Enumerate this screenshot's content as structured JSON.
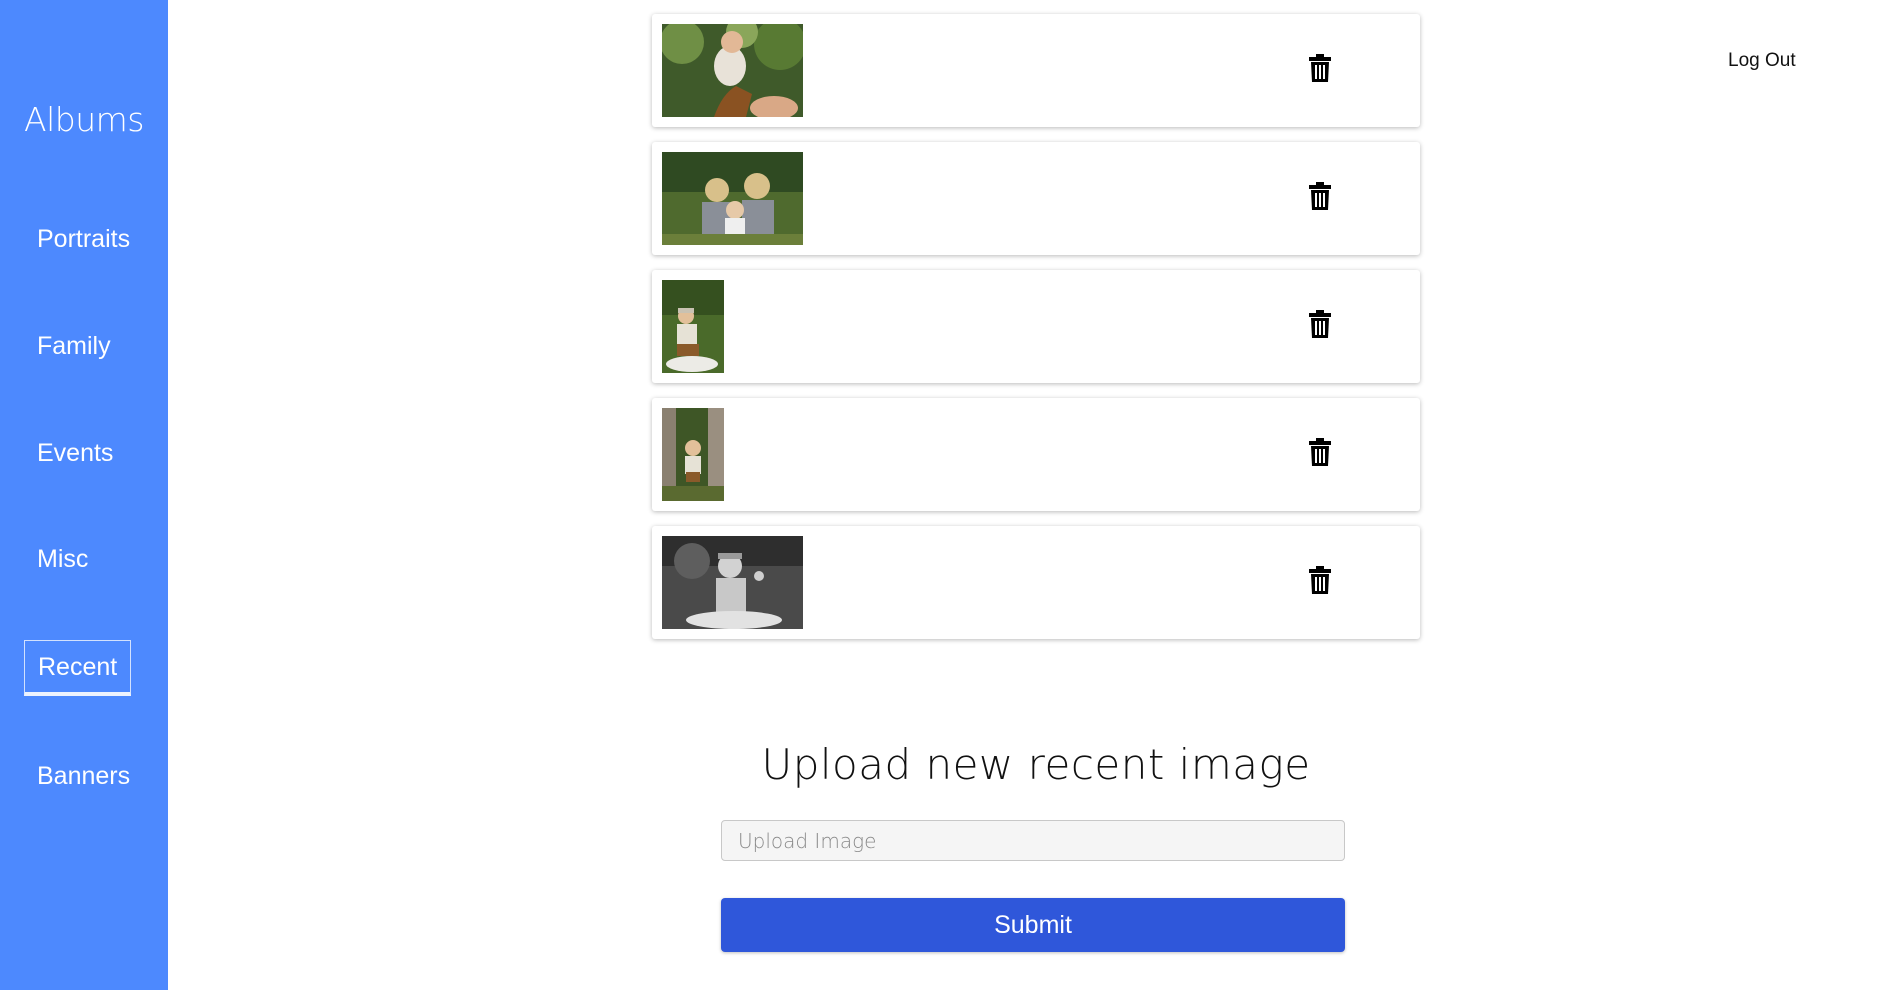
{
  "sidebar": {
    "title": "Albums",
    "items": [
      {
        "label": "Portraits",
        "active": false
      },
      {
        "label": "Family",
        "active": false
      },
      {
        "label": "Events",
        "active": false
      },
      {
        "label": "Misc",
        "active": false
      },
      {
        "label": "Recent",
        "active": true
      },
      {
        "label": "Banners",
        "active": false
      }
    ]
  },
  "header": {
    "logout_label": "Log Out"
  },
  "images": [
    {
      "thumb": "baby-lifted-photo",
      "orientation": "landscape",
      "delete_icon": "trash-icon"
    },
    {
      "thumb": "three-children-photo",
      "orientation": "landscape",
      "delete_icon": "trash-icon"
    },
    {
      "thumb": "toddler-sitting-photo",
      "orientation": "portrait",
      "delete_icon": "trash-icon"
    },
    {
      "thumb": "toddler-standing-photo",
      "orientation": "portrait",
      "delete_icon": "trash-icon"
    },
    {
      "thumb": "toddler-bw-photo",
      "orientation": "landscape",
      "delete_icon": "trash-icon"
    }
  ],
  "upload": {
    "title": "Upload new recent image",
    "placeholder": "Upload Image",
    "submit_label": "Submit"
  },
  "colors": {
    "sidebar_bg": "#4d89fe",
    "submit_bg": "#2f57da",
    "text": "#111111"
  }
}
